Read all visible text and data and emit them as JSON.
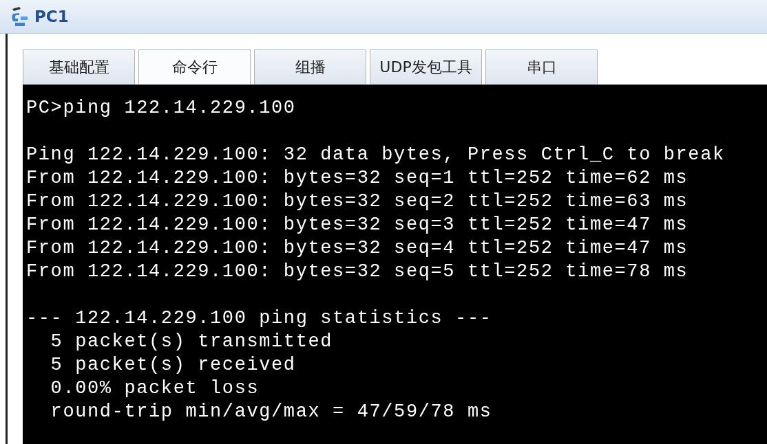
{
  "window": {
    "title": "PC1"
  },
  "tabs": [
    {
      "label": "基础配置",
      "selected": false
    },
    {
      "label": "命令行",
      "selected": true
    },
    {
      "label": "组播",
      "selected": false
    },
    {
      "label": "UDP发包工具",
      "selected": false
    },
    {
      "label": "串口",
      "selected": false
    }
  ],
  "terminal": {
    "blocks": [
      [
        "PC>ping 122.14.229.100"
      ],
      [
        "Ping 122.14.229.100: 32 data bytes, Press Ctrl_C to break",
        "From 122.14.229.100: bytes=32 seq=1 ttl=252 time=62 ms",
        "From 122.14.229.100: bytes=32 seq=2 ttl=252 time=63 ms",
        "From 122.14.229.100: bytes=32 seq=3 ttl=252 time=47 ms",
        "From 122.14.229.100: bytes=32 seq=4 ttl=252 time=47 ms",
        "From 122.14.229.100: bytes=32 seq=5 ttl=252 time=78 ms"
      ],
      [
        "--- 122.14.229.100 ping statistics ---",
        "  5 packet(s) transmitted",
        "  5 packet(s) received",
        "  0.00% packet loss",
        "  round-trip min/avg/max = 47/59/78 ms"
      ]
    ]
  }
}
